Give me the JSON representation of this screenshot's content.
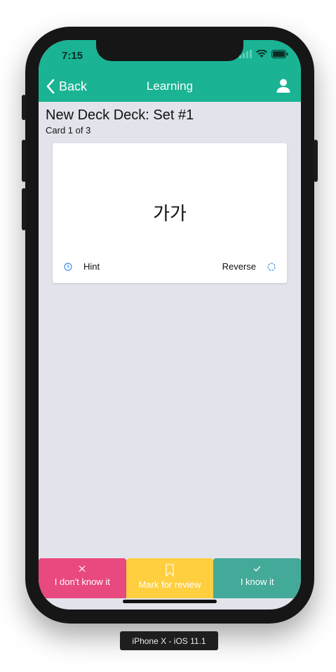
{
  "status_bar": {
    "time": "7:15"
  },
  "nav": {
    "back_label": "Back",
    "title": "Learning"
  },
  "deck": {
    "title": "New Deck Deck: Set #1",
    "card_count": "Card 1 of 3"
  },
  "card": {
    "word": "가가",
    "hint_label": "Hint",
    "reverse_label": "Reverse"
  },
  "actions": {
    "dont_know": "I don't know it",
    "mark_review": "Mark for review",
    "know": "I know it"
  },
  "device_label": "iPhone X - iOS 11.1",
  "colors": {
    "header": "#1ab394",
    "background": "#e2e3eb",
    "dont_know": "#e8497e",
    "mark_review": "#ffcf3f",
    "know": "#43a998",
    "icon_blue": "#3b8ee8"
  },
  "icons": {
    "back": "chevron-left-icon",
    "user": "user-icon",
    "hint": "clock-icon",
    "reverse": "refresh-icon",
    "dont_know": "close-icon",
    "mark_review": "bookmark-icon",
    "know": "check-icon"
  }
}
